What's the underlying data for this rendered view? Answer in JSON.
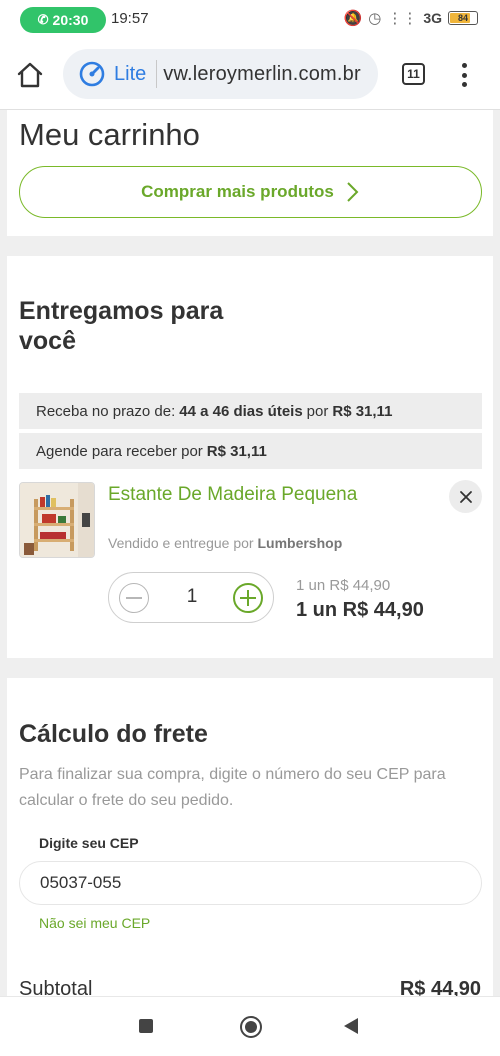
{
  "status_bar": {
    "call_time": "20:30",
    "clock": "19:57",
    "network": "3G",
    "battery": "84"
  },
  "browser": {
    "lite_label": "Lite",
    "url": "vw.leroymerlin.com.br",
    "tab_count": "11"
  },
  "cart": {
    "title": "Meu carrinho",
    "buy_more_label": "Comprar mais produtos"
  },
  "delivery": {
    "title": "Entregamos para você",
    "row1_prefix": "Receba no prazo de:",
    "row1_days": "44 a 46 dias úteis",
    "row1_mid": "por",
    "row1_price": "R$ 31,11",
    "row2_prefix": "Agende para receber por",
    "row2_price": "R$ 31,11",
    "product": {
      "name": "Estante De Madeira Pequena",
      "seller_prefix": "Vendido e entregue por",
      "seller_name": "Lumbershop",
      "quantity": "1",
      "unit_price": "1 un R$ 44,90",
      "total_price": "1 un R$ 44,90"
    }
  },
  "shipping": {
    "title": "Cálculo do frete",
    "description": "Para finalizar sua compra, digite o número do seu CEP para calcular o frete do seu pedido.",
    "cep_label": "Digite seu CEP",
    "cep_value": "05037-055",
    "unknown_cep_link": "Não sei meu CEP",
    "subtotal_label": "Subtotal",
    "subtotal_value": "R$ 44,90"
  },
  "colors": {
    "accent_green": "#6aa82a",
    "call_pill_green": "#31c46a",
    "lite_blue": "#2f7de1"
  },
  "icons": {
    "call": "phone-icon",
    "home": "home-icon",
    "lite": "speedometer-icon",
    "menu": "more-vertical-icon",
    "chevron": "chevron-right-icon",
    "remove": "close-icon"
  }
}
